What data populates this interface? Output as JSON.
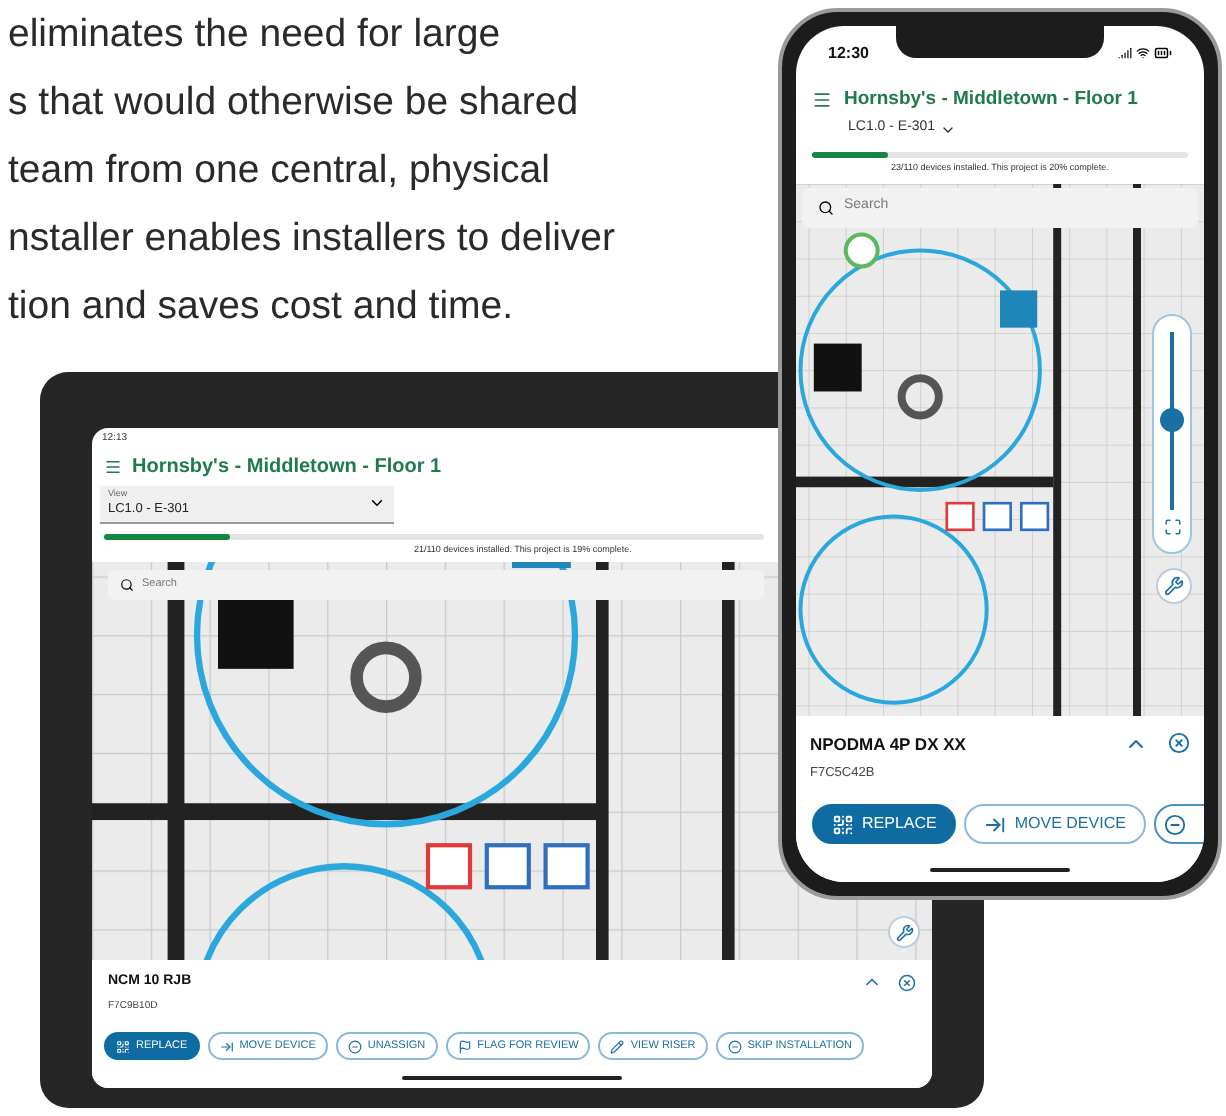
{
  "intro_lines": [
    "eliminates the need for large",
    "s that would otherwise be shared",
    "team from one central, physical",
    "nstaller enables installers to deliver",
    "tion and saves cost and time."
  ],
  "tablet": {
    "status_time": "12:13",
    "title": "Hornsby's - Middletown - Floor 1",
    "view": {
      "label": "View",
      "value": "LC1.0 - E-301"
    },
    "progress": {
      "level": 0.19,
      "text": "21/110 devices installed. This project is 19% complete."
    },
    "search": {
      "placeholder": "Search"
    },
    "device": {
      "name": "NCM 10 RJB",
      "id": "F7C9B10D"
    },
    "actions": [
      {
        "label": "REPLACE",
        "kind": "primary"
      },
      {
        "label": "MOVE DEVICE",
        "kind": "outline"
      },
      {
        "label": "UNASSIGN",
        "kind": "outline"
      },
      {
        "label": "FLAG FOR REVIEW",
        "kind": "outline"
      },
      {
        "label": "VIEW RISER",
        "kind": "outline"
      },
      {
        "label": "SKIP INSTALLATION",
        "kind": "outline"
      }
    ]
  },
  "phone": {
    "status_time": "12:30",
    "title": "Hornsby's - Middletown - Floor 1",
    "view": {
      "value": "LC1.0 - E-301"
    },
    "progress": {
      "level": 0.2,
      "text": "23/110 devices installed. This project is 20% complete."
    },
    "search": {
      "placeholder": "Search"
    },
    "zoom_slider": {
      "level": 0.5
    },
    "device": {
      "name": "NPODMA 4P DX XX",
      "id": "F7C5C42B"
    },
    "actions": [
      {
        "label": "REPLACE",
        "kind": "primary"
      },
      {
        "label": "MOVE DEVICE",
        "kind": "outline"
      },
      {
        "kind": "cut"
      }
    ]
  }
}
